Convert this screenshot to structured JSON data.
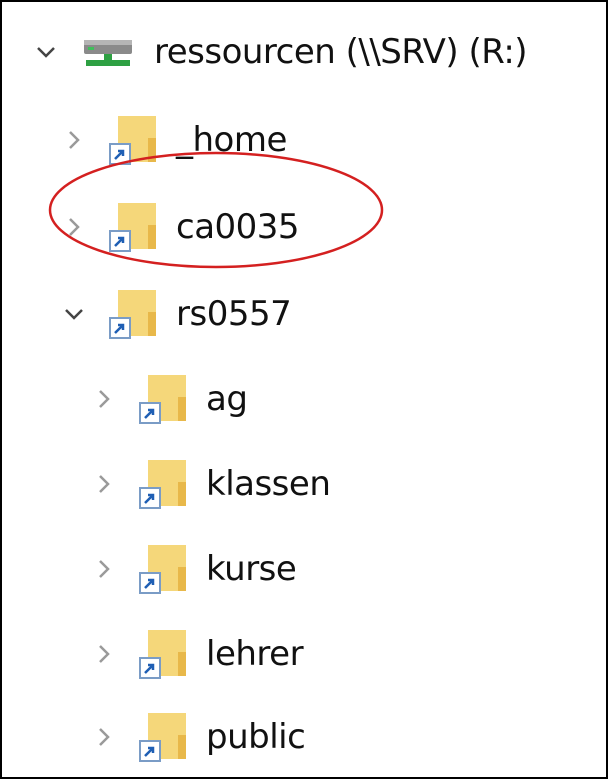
{
  "tree": {
    "root": {
      "label": "ressourcen (\\\\SRV) (R:)",
      "state": "expanded",
      "icon": "network-drive-icon"
    },
    "items": [
      {
        "label": "_home",
        "state": "collapsed",
        "icon": "folder-shortcut-icon"
      },
      {
        "label": "ca0035",
        "state": "collapsed",
        "icon": "folder-shortcut-icon"
      },
      {
        "label": "rs0557",
        "state": "expanded",
        "icon": "folder-shortcut-icon"
      },
      {
        "label": "ag",
        "state": "collapsed",
        "icon": "folder-shortcut-icon"
      },
      {
        "label": "klassen",
        "state": "collapsed",
        "icon": "folder-shortcut-icon"
      },
      {
        "label": "kurse",
        "state": "collapsed",
        "icon": "folder-shortcut-icon"
      },
      {
        "label": "lehrer",
        "state": "collapsed",
        "icon": "folder-shortcut-icon"
      },
      {
        "label": "public",
        "state": "collapsed",
        "icon": "folder-shortcut-icon"
      }
    ]
  },
  "annotation": {
    "shape": "ellipse",
    "color": "#d42020",
    "target": "ca0035"
  },
  "colors": {
    "folder": "#f5d77a",
    "folder_dark": "#e8b84a",
    "drive_green": "#2ea043",
    "chevron": "#9a9a9a",
    "chevron_open": "#444444"
  }
}
